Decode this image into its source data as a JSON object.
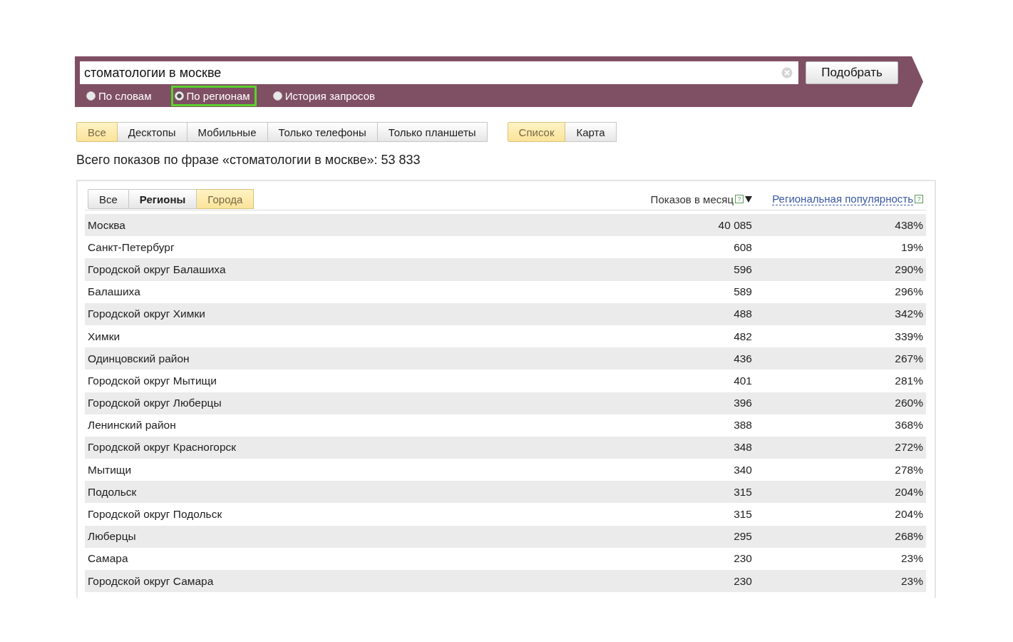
{
  "search": {
    "query": "стоматологии в москве",
    "button": "Подобрать"
  },
  "modes": [
    {
      "label": "По словам",
      "selected": false,
      "highlighted": false
    },
    {
      "label": "По регионам",
      "selected": true,
      "highlighted": true
    },
    {
      "label": "История запросов",
      "selected": false,
      "highlighted": false
    }
  ],
  "device_tabs": [
    {
      "label": "Все",
      "selected": true
    },
    {
      "label": "Десктопы",
      "selected": false
    },
    {
      "label": "Мобильные",
      "selected": false
    },
    {
      "label": "Только телефоны",
      "selected": false
    },
    {
      "label": "Только планшеты",
      "selected": false
    }
  ],
  "view_tabs": [
    {
      "label": "Список",
      "selected": true
    },
    {
      "label": "Карта",
      "selected": false
    }
  ],
  "summary": "Всего показов по фразе «стоматологии в москве»: 53 833",
  "region_tabs": [
    {
      "label": "Все",
      "selected": false,
      "bold": false
    },
    {
      "label": "Регионы",
      "selected": false,
      "bold": true
    },
    {
      "label": "Города",
      "selected": true,
      "bold": false
    }
  ],
  "table": {
    "columns": [
      null,
      {
        "label": "Показов в месяц",
        "help": "?",
        "sorted": true
      },
      {
        "label": "Региональная популярность",
        "help": "?"
      }
    ],
    "rows": [
      [
        "Москва",
        "40 085",
        "438%"
      ],
      [
        "Санкт-Петербург",
        "608",
        "19%"
      ],
      [
        "Городской округ Балашиха",
        "596",
        "290%"
      ],
      [
        "Балашиха",
        "589",
        "296%"
      ],
      [
        "Городской округ Химки",
        "488",
        "342%"
      ],
      [
        "Химки",
        "482",
        "339%"
      ],
      [
        "Одинцовский район",
        "436",
        "267%"
      ],
      [
        "Городской округ Мытищи",
        "401",
        "281%"
      ],
      [
        "Городской округ Люберцы",
        "396",
        "260%"
      ],
      [
        "Ленинский район",
        "388",
        "368%"
      ],
      [
        "Городской округ Красногорск",
        "348",
        "272%"
      ],
      [
        "Мытищи",
        "340",
        "278%"
      ],
      [
        "Подольск",
        "315",
        "204%"
      ],
      [
        "Городской округ Подольск",
        "315",
        "204%"
      ],
      [
        "Люберцы",
        "295",
        "268%"
      ],
      [
        "Самара",
        "230",
        "23%"
      ],
      [
        "Городской округ Самара",
        "230",
        "23%"
      ]
    ]
  }
}
